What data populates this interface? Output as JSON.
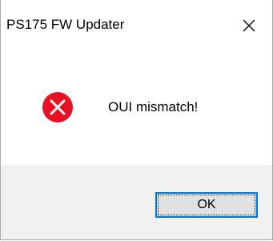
{
  "window": {
    "title": "PS175 FW Updater",
    "close_icon": "close-icon"
  },
  "message": {
    "icon": "error-icon",
    "text": "OUI mismatch!",
    "icon_color": "#e81123"
  },
  "buttons": {
    "ok_label": "OK",
    "ok_border_color": "#0078d7"
  }
}
